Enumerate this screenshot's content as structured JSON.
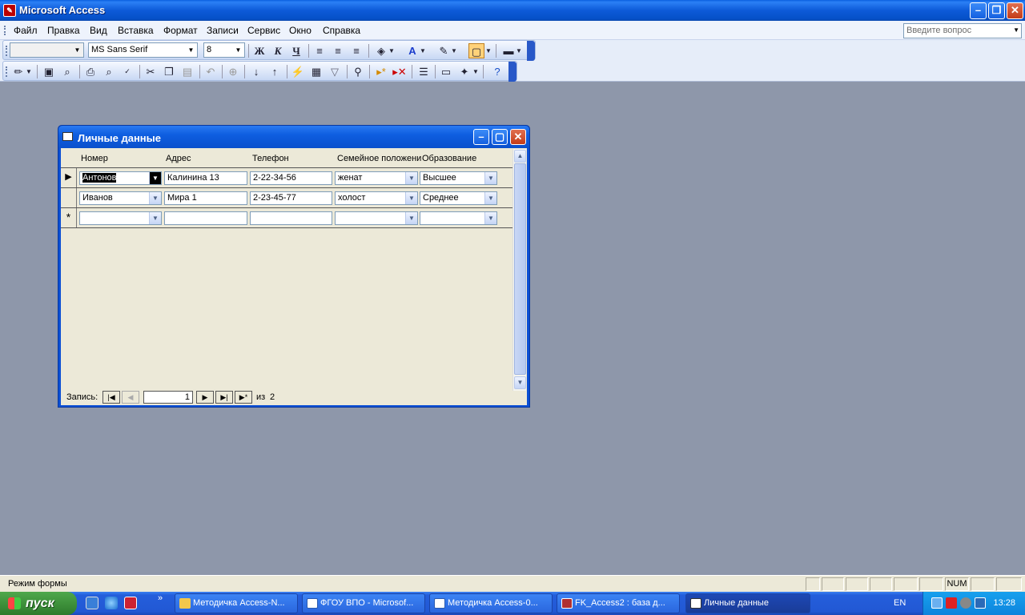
{
  "window": {
    "title": "Microsoft Access"
  },
  "menu": {
    "items": [
      "Файл",
      "Правка",
      "Вид",
      "Вставка",
      "Формат",
      "Записи",
      "Сервис",
      "Окно",
      "Справка"
    ],
    "ask_placeholder": "Введите вопрос"
  },
  "format_toolbar": {
    "object_value": "",
    "font_name": "MS Sans Serif",
    "font_size": "8",
    "bold_label": "Ж",
    "italic_label": "К",
    "underline_label": "Ч"
  },
  "form": {
    "title": "Личные данные",
    "columns": [
      "Номер",
      "Адрес",
      "Телефон",
      "Семейное положени",
      "Образование"
    ],
    "rows": [
      {
        "selector": "▶",
        "cells": [
          "Антонов",
          "Калинина 13",
          "2-22-34-56",
          "женат",
          "Высшее"
        ]
      },
      {
        "selector": "",
        "cells": [
          "Иванов",
          "Мира 1",
          "2-23-45-77",
          "холост",
          "Среднее"
        ]
      },
      {
        "selector": "*",
        "cells": [
          "",
          "",
          "",
          "",
          ""
        ]
      }
    ],
    "nav": {
      "label": "Запись:",
      "current": "1",
      "of_label": "из",
      "total": "2"
    }
  },
  "statusbar": {
    "mode": "Режим формы",
    "num": "NUM"
  },
  "taskbar": {
    "start_label": "пуск",
    "tasks": [
      "Методичка Access-N...",
      "ФГОУ ВПО - Microsof...",
      "Методичка Access-0...",
      "FK_Access2 : база д...",
      "Личные данные"
    ],
    "lang": "EN",
    "clock": "13:28"
  }
}
